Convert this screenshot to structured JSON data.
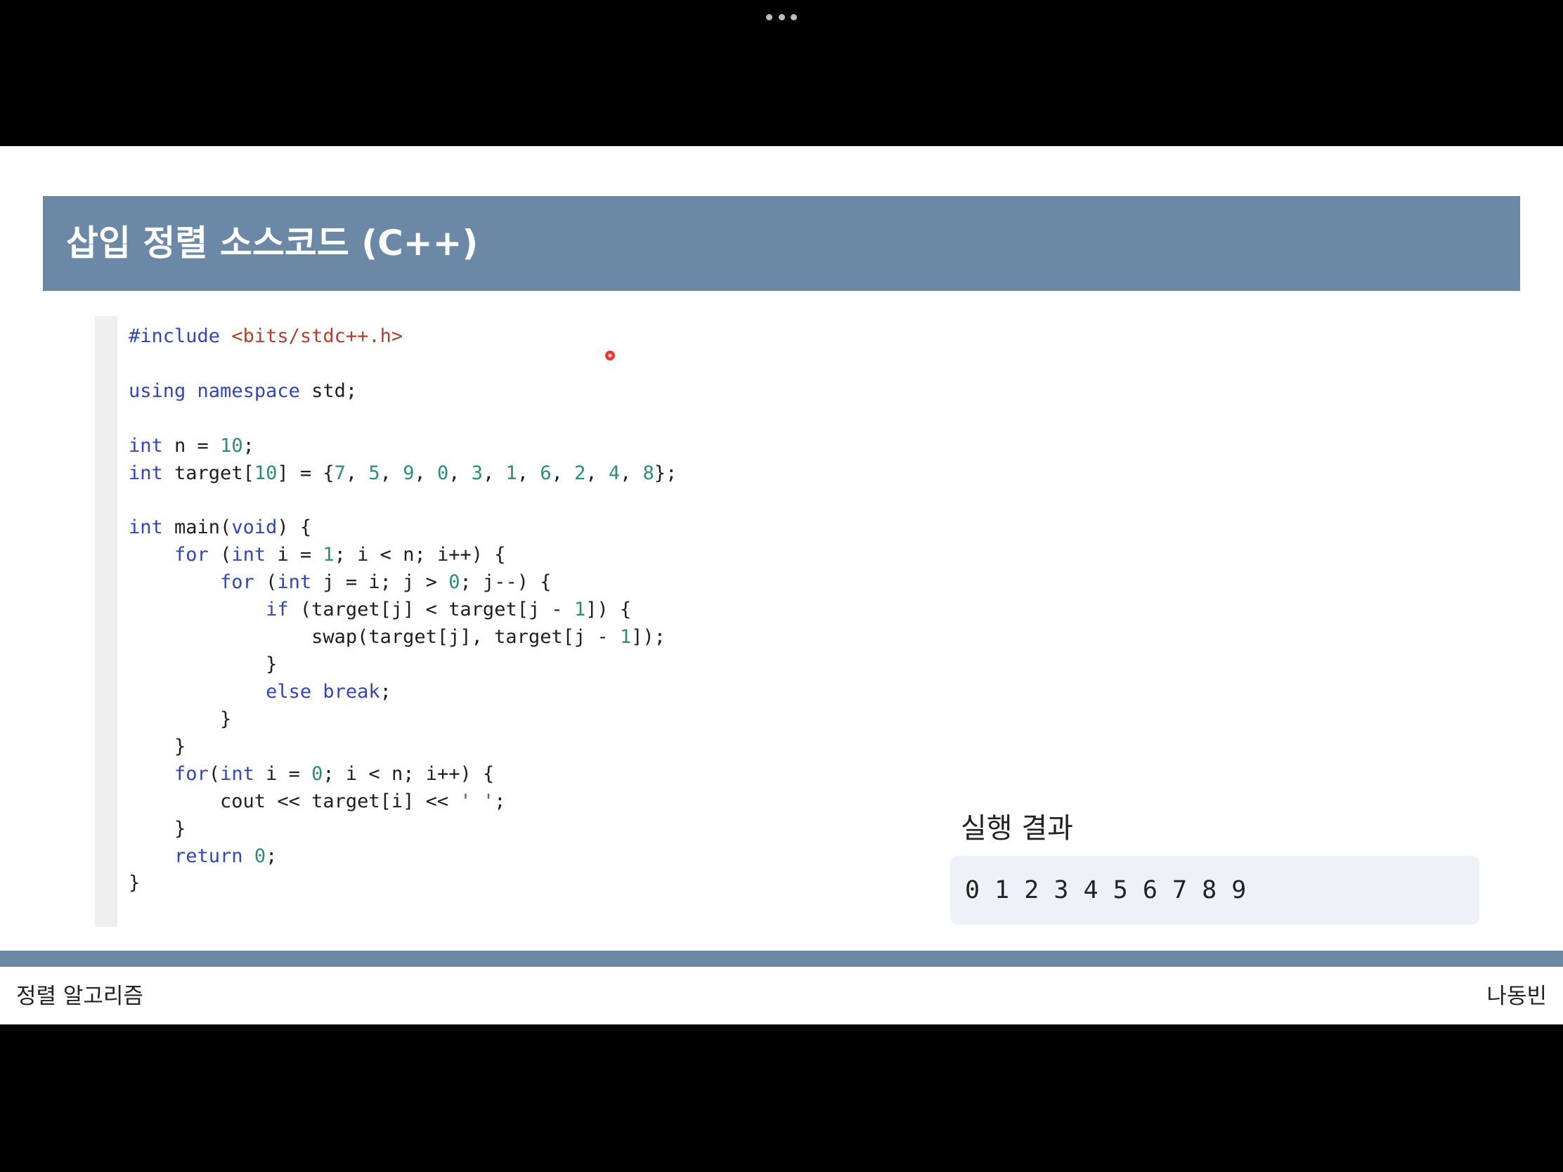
{
  "top_bar": {
    "menu_icon": "more-dots-icon"
  },
  "slide": {
    "title": "삽입 정렬 소스코드 (C++)",
    "code": {
      "lines": [
        "#include <bits/stdc++.h>",
        "",
        "using namespace std;",
        "",
        "int n = 10;",
        "int target[10] = {7, 5, 9, 0, 3, 1, 6, 2, 4, 8};",
        "",
        "int main(void) {",
        "    for (int i = 1; i < n; i++) {",
        "        for (int j = i; j > 0; j--) {",
        "            if (target[j] < target[j - 1]) {",
        "                swap(target[j], target[j - 1]);",
        "            }",
        "            else break;",
        "        }",
        "    }",
        "    for(int i = 0; i < n; i++) {",
        "        cout << target[i] << ' ';",
        "    }",
        "    return 0;",
        "}"
      ]
    },
    "pointer_icon": "laser-pointer-dot-icon",
    "result": {
      "label": "실행 결과",
      "output": "0 1 2 3 4 5 6 7 8 9"
    },
    "footer": {
      "topic": "정렬 알고리즘",
      "author": "나동빈"
    }
  },
  "colors": {
    "accent": "#6B88A6",
    "code_text": "#1E1E1E",
    "keyword": "#3346B8",
    "number": "#2E8B76",
    "string": "#B0402E",
    "gutter": "#EFEFEF",
    "result_bg": "#EDF2F8",
    "pointer": "#E53935"
  }
}
